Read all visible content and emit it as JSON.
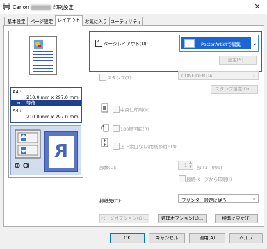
{
  "window": {
    "title_prefix": "Canon",
    "title_suffix": "印刷設定",
    "close_glyph": "✕"
  },
  "tabs": [
    {
      "label": "基本設定"
    },
    {
      "label": "ページ設定"
    },
    {
      "label": "レイアウト"
    },
    {
      "label": "お気に入り"
    },
    {
      "label": "ユーティリティ"
    }
  ],
  "paper_info": {
    "top_label": "A4 :",
    "top_size": "210.0 mm x 297.0 mm",
    "band_label": "等倍",
    "band_arrow": "➜",
    "bottom_label": "A4 :",
    "bottom_size": "210.0 mm x 297.0 mm"
  },
  "preview": {
    "big_letter": "R"
  },
  "page_layout": {
    "checkbox_label": "ページレイアウト(U):",
    "selected_value": "PosterArtistで編集",
    "settings_button": "設定(S)..."
  },
  "stamp": {
    "checkbox_label": "スタンプ(T):",
    "value": "CONFIDENTIAL",
    "settings_button": "スタンプ設定(D)..."
  },
  "options": {
    "center": "中央に印刷(N)",
    "rotate": "180度回転(R)",
    "flip": "上下余白なし(用紙節約)(M)"
  },
  "copies": {
    "label": "部数(C):",
    "value": "1",
    "unit": "部 (1 - 999)",
    "last_page_first": "最終ページから印刷(I)"
  },
  "output": {
    "label": "排紙先(O):",
    "value": "プリンター設定に従う"
  },
  "buttons": {
    "page_options": "ページオプション(G)...",
    "process_options": "処理オプション(L)...",
    "restore_defaults": "標準に戻す(F)",
    "ok": "OK",
    "cancel": "キャンセル",
    "apply": "適用(A)",
    "help": "ヘルプ"
  },
  "colors": {
    "highlight_border": "#e1242b",
    "selection_blue": "#1c65d4",
    "paper_band": "#1f3f8f"
  }
}
